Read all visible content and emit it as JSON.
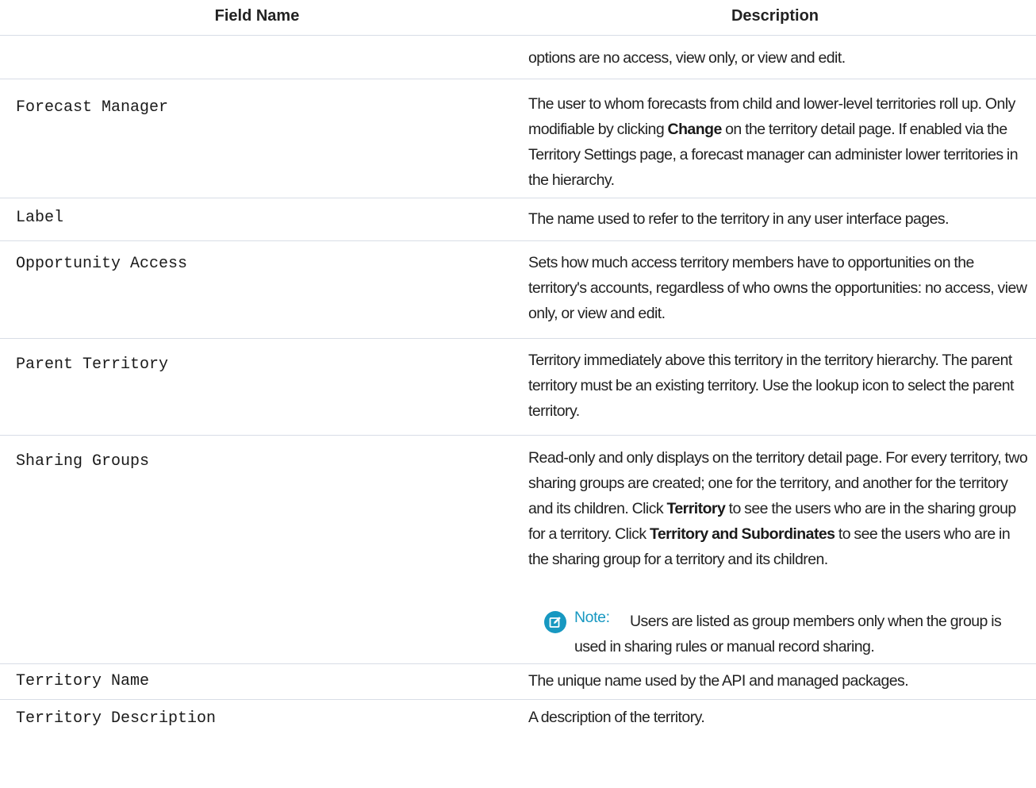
{
  "table": {
    "headers": {
      "field_name": "Field Name",
      "description": "Description"
    },
    "continuation_text": "options are no access, view only, or view and edit.",
    "rows": [
      {
        "name": "Forecast Manager",
        "desc_parts": [
          "The user to whom forecasts from child and lower-level territories roll up. Only modifiable by clicking ",
          "Change",
          " on the territory detail page. If enabled via the Territory Settings page, a forecast manager can administer lower territories in the hierarchy."
        ]
      },
      {
        "name": "Label",
        "description": "The name used to refer to the territory in any user interface pages."
      },
      {
        "name": "Opportunity Access",
        "description": "Sets how much access territory members have to opportunities on the territory's accounts, regardless of who owns the opportunities: no access, view only, or view and edit."
      },
      {
        "name": "Parent Territory",
        "description": "Territory immediately above this territory in the territory hierarchy. The parent territory must be an existing territory. Use the lookup icon to select the parent territory."
      },
      {
        "name": "Sharing Groups",
        "desc_parts": [
          "Read-only and only displays on the territory detail page. For every territory, two sharing groups are created; one for the territory, and another for the territory and its children. Click ",
          "Territory",
          " to see the users who are in the sharing group for a territory. Click ",
          "Territory and Subordinates",
          " to see the users who are in the sharing group for a territory and its children."
        ],
        "note": {
          "icon": "edit-note-icon",
          "label": "Note:",
          "text": "Users are listed as group members only when the group is used in sharing rules or manual record sharing."
        }
      },
      {
        "name": "Territory Name",
        "description": "The unique name used by the API and managed packages."
      },
      {
        "name": "Territory Description",
        "description": "A description of the territory."
      }
    ]
  },
  "colors": {
    "border": "#d8dde6",
    "note_accent": "#1798c1",
    "text": "#222222"
  }
}
